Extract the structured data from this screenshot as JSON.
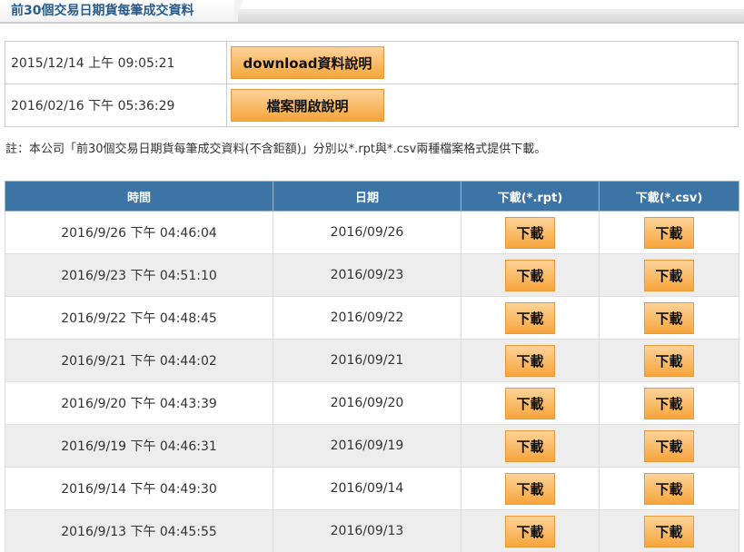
{
  "header": {
    "title": "前30個交易日期貨每筆成交資料"
  },
  "info": {
    "rows": [
      {
        "timestamp": "2015/12/14 上午 09:05:21",
        "button": "download資料說明"
      },
      {
        "timestamp": "2016/02/16 下午 05:36:29",
        "button": "檔案開啟說明"
      }
    ]
  },
  "note": "註：本公司「前30個交易日期貨每筆成交資料(不含鉅額)」分別以*.rpt與*.csv兩種檔案格式提供下載。",
  "table": {
    "headers": [
      "時間",
      "日期",
      "下載(*.rpt)",
      "下載(*.csv)"
    ],
    "download_label": "下載",
    "rows": [
      {
        "time": "2016/9/26 下午 04:46:04",
        "date": "2016/09/26"
      },
      {
        "time": "2016/9/23 下午 04:51:10",
        "date": "2016/09/23"
      },
      {
        "time": "2016/9/22 下午 04:48:45",
        "date": "2016/09/22"
      },
      {
        "time": "2016/9/21 下午 04:44:02",
        "date": "2016/09/21"
      },
      {
        "time": "2016/9/20 下午 04:43:39",
        "date": "2016/09/20"
      },
      {
        "time": "2016/9/19 下午 04:46:31",
        "date": "2016/09/19"
      },
      {
        "time": "2016/9/14 下午 04:49:30",
        "date": "2016/09/14"
      },
      {
        "time": "2016/9/13 下午 04:45:55",
        "date": "2016/09/13"
      }
    ]
  },
  "colors": {
    "header_bg": "#3b74a5",
    "button_top": "#fdd399",
    "button_bottom": "#f7a53b",
    "title_text": "#2b5c8a",
    "alt_row": "#ededed"
  }
}
